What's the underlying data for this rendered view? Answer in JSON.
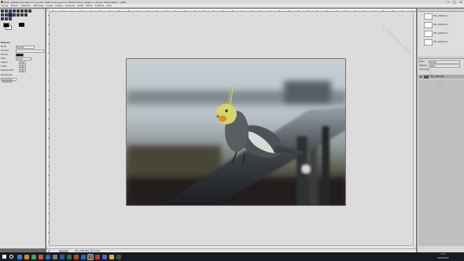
{
  "window": {
    "title": "[IMG_2684] (importé)-4.0 (couleur RVB 8 bits gamma, GIMP built-in sRGB, 1 calque) 2816x1880 – GIMP",
    "controls": [
      "—",
      "□",
      "✕"
    ]
  },
  "menubar": {
    "items": [
      "Fichier",
      "Édition",
      "Sélection",
      "Affichage",
      "Image",
      "Calque",
      "Couleurs",
      "Outils",
      "Filtres",
      "Fenêtres",
      "Aide"
    ]
  },
  "tool_options": {
    "title": "Pinceau",
    "mode_label": "Mode",
    "mode_value": "Normal",
    "opacity_label": "Opacité",
    "brush_label": "Brosse",
    "size_label": "Taille",
    "size_value": "51,00",
    "aspect_label": "Aspect",
    "angle_label": "Angle",
    "spacing_label": "Espacement",
    "dynamics_label": "Dynamique",
    "dynamics_value": "Dynamique désactivée",
    "field_a": "0,00",
    "field_b": "0,00",
    "field_c": "0,00"
  },
  "statusbar": {
    "unit": "px",
    "zoom": "21,7 %",
    "message": "IMG_2684.JPG (97,7 Mio)"
  },
  "right_dock": {
    "thumbs": [
      {
        "label": "IMG_2684.JPG-1"
      },
      {
        "label": "IMG_2684.JPG-2"
      },
      {
        "label": "IMG_2684.JPG-3"
      },
      {
        "label": "IMG_2684.JPG-4"
      }
    ],
    "mode_label": "Mode",
    "mode_value": "Normal",
    "opacity_label": "Opacité",
    "opacity_value": "100,0",
    "lock_label": "Verrouiller :",
    "layer_name": "IMG_2684.JPG"
  },
  "watermark": "© Éditions ENI – Tous droits réservés",
  "taskbar": {
    "time": "17:11",
    "date": "15/05/2018"
  },
  "colors": {
    "taskbar_bg": "#161b24",
    "canvas_bg": "#dcdcdc",
    "selected_layer": "#a9a9a9"
  }
}
